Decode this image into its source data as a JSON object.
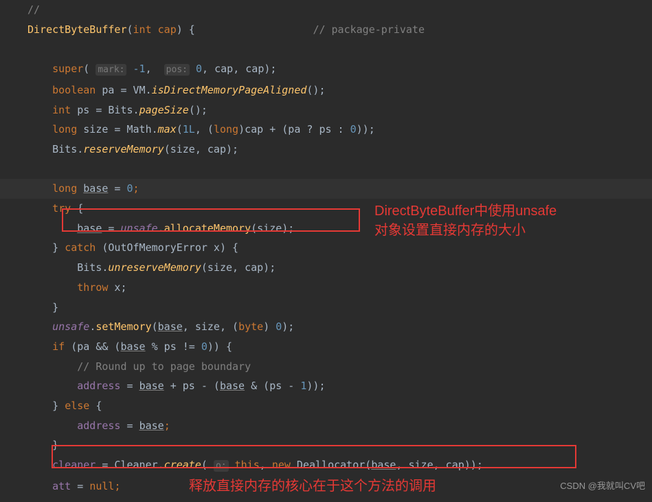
{
  "code": {
    "l1": "//",
    "l2_name": "DirectByteBuffer",
    "l2_params": "int cap",
    "l2_comment": "// package-private",
    "l4_super": "super",
    "l4_mark": "mark:",
    "l4_markval": "-1",
    "l4_pos": "pos:",
    "l4_posval": "0",
    "l4_rest": ", cap, cap);",
    "l5_kw": "boolean",
    "l5_var": "pa",
    "l5_eq": " = VM.",
    "l5_method": "isDirectMemoryPageAligned",
    "l5_end": "();",
    "l6_kw": "int",
    "l6_var": "ps",
    "l6_eq": " = Bits.",
    "l6_method": "pageSize",
    "l6_end": "();",
    "l7_kw": "long",
    "l7_var": "size",
    "l7_eq": " = Math.",
    "l7_method": "max",
    "l7_open": "(",
    "l7_num1": "1L",
    "l7_mid": ", (",
    "l7_cast": "long",
    "l7_rest1": ")cap + (pa ? ps : ",
    "l7_num2": "0",
    "l7_end": "));",
    "l8_pre": "Bits.",
    "l8_method": "reserveMemory",
    "l8_args": "(size, cap);",
    "l10_kw": "long",
    "l10_var": "base",
    "l10_eq": " = ",
    "l10_num": "0",
    "l10_end": ";",
    "l11_try": "try",
    "l11_brace": " {",
    "l12_var": "base",
    "l12_eq": " = ",
    "l12_unsafe": "unsafe",
    "l12_dot": ".",
    "l12_method": "allocateMemory",
    "l12_args": "(size);",
    "l13_close": "} ",
    "l13_catch": "catch",
    "l13_args": " (OutOfMemoryError x) {",
    "l14_pre": "Bits.",
    "l14_method": "unreserveMemory",
    "l14_args": "(size, cap);",
    "l15_throw": "throw",
    "l15_rest": " x;",
    "l16": "}",
    "l17_unsafe": "unsafe",
    "l17_dot": ".",
    "l17_method": "setMemory",
    "l17_open": "(",
    "l17_base": "base",
    "l17_mid": ", size, (",
    "l17_byte": "byte",
    "l17_close": ") ",
    "l17_num": "0",
    "l17_end": ");",
    "l18_if": "if",
    "l18_open": " (pa && (",
    "l18_base": "base",
    "l18_mid": " % ps != ",
    "l18_num": "0",
    "l18_end": ")) {",
    "l19_comment": "// Round up to page boundary",
    "l20_addr": "address",
    "l20_eq": " = ",
    "l20_base1": "base",
    "l20_mid": " + ps - (",
    "l20_base2": "base",
    "l20_mid2": " & (ps - ",
    "l20_num": "1",
    "l20_end": "));",
    "l21_close": "} ",
    "l21_else": "else",
    "l21_brace": " {",
    "l22_addr": "address",
    "l22_eq": " = ",
    "l22_base": "base",
    "l22_end": ";",
    "l23": "}",
    "l24_cleaner": "cleaner",
    "l24_eq": " = Cleaner.",
    "l24_create": "create",
    "l24_open": "( ",
    "l24_hint": "o:",
    "l24_this": "this",
    "l24_mid": ", ",
    "l24_new": "new",
    "l24_dealloc": " Deallocator(",
    "l24_base": "base",
    "l24_end": ", size, cap));",
    "l25_att": "att",
    "l25_eq": " = ",
    "l25_null": "null",
    "l25_end": ";"
  },
  "annotations": {
    "note1_line1": "DirectByteBuffer中使用unsafe",
    "note1_line2": "对象设置直接内存的大小",
    "note2": "释放直接内存的核心在于这个方法的调用"
  },
  "watermark": "CSDN @我就叫CV吧"
}
